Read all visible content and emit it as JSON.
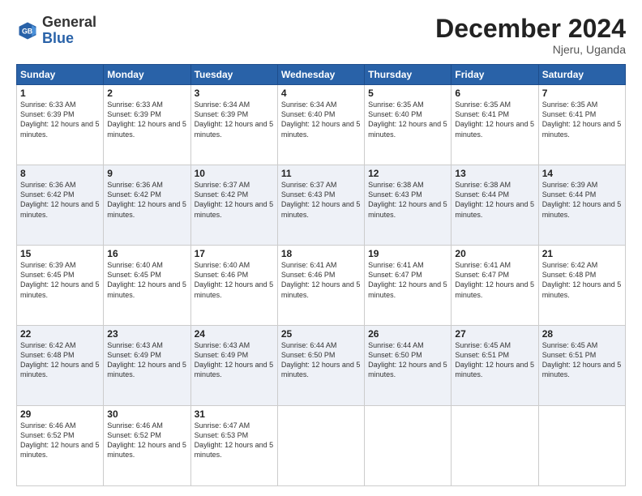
{
  "header": {
    "logo_general": "General",
    "logo_blue": "Blue",
    "month_title": "December 2024",
    "subtitle": "Njeru, Uganda"
  },
  "days_of_week": [
    "Sunday",
    "Monday",
    "Tuesday",
    "Wednesday",
    "Thursday",
    "Friday",
    "Saturday"
  ],
  "weeks": [
    [
      {
        "day": "1",
        "sunrise": "6:33 AM",
        "sunset": "6:39 PM",
        "daylight": "12 hours and 5 minutes."
      },
      {
        "day": "2",
        "sunrise": "6:33 AM",
        "sunset": "6:39 PM",
        "daylight": "12 hours and 5 minutes."
      },
      {
        "day": "3",
        "sunrise": "6:34 AM",
        "sunset": "6:39 PM",
        "daylight": "12 hours and 5 minutes."
      },
      {
        "day": "4",
        "sunrise": "6:34 AM",
        "sunset": "6:40 PM",
        "daylight": "12 hours and 5 minutes."
      },
      {
        "day": "5",
        "sunrise": "6:35 AM",
        "sunset": "6:40 PM",
        "daylight": "12 hours and 5 minutes."
      },
      {
        "day": "6",
        "sunrise": "6:35 AM",
        "sunset": "6:41 PM",
        "daylight": "12 hours and 5 minutes."
      },
      {
        "day": "7",
        "sunrise": "6:35 AM",
        "sunset": "6:41 PM",
        "daylight": "12 hours and 5 minutes."
      }
    ],
    [
      {
        "day": "8",
        "sunrise": "6:36 AM",
        "sunset": "6:42 PM",
        "daylight": "12 hours and 5 minutes."
      },
      {
        "day": "9",
        "sunrise": "6:36 AM",
        "sunset": "6:42 PM",
        "daylight": "12 hours and 5 minutes."
      },
      {
        "day": "10",
        "sunrise": "6:37 AM",
        "sunset": "6:42 PM",
        "daylight": "12 hours and 5 minutes."
      },
      {
        "day": "11",
        "sunrise": "6:37 AM",
        "sunset": "6:43 PM",
        "daylight": "12 hours and 5 minutes."
      },
      {
        "day": "12",
        "sunrise": "6:38 AM",
        "sunset": "6:43 PM",
        "daylight": "12 hours and 5 minutes."
      },
      {
        "day": "13",
        "sunrise": "6:38 AM",
        "sunset": "6:44 PM",
        "daylight": "12 hours and 5 minutes."
      },
      {
        "day": "14",
        "sunrise": "6:39 AM",
        "sunset": "6:44 PM",
        "daylight": "12 hours and 5 minutes."
      }
    ],
    [
      {
        "day": "15",
        "sunrise": "6:39 AM",
        "sunset": "6:45 PM",
        "daylight": "12 hours and 5 minutes."
      },
      {
        "day": "16",
        "sunrise": "6:40 AM",
        "sunset": "6:45 PM",
        "daylight": "12 hours and 5 minutes."
      },
      {
        "day": "17",
        "sunrise": "6:40 AM",
        "sunset": "6:46 PM",
        "daylight": "12 hours and 5 minutes."
      },
      {
        "day": "18",
        "sunrise": "6:41 AM",
        "sunset": "6:46 PM",
        "daylight": "12 hours and 5 minutes."
      },
      {
        "day": "19",
        "sunrise": "6:41 AM",
        "sunset": "6:47 PM",
        "daylight": "12 hours and 5 minutes."
      },
      {
        "day": "20",
        "sunrise": "6:41 AM",
        "sunset": "6:47 PM",
        "daylight": "12 hours and 5 minutes."
      },
      {
        "day": "21",
        "sunrise": "6:42 AM",
        "sunset": "6:48 PM",
        "daylight": "12 hours and 5 minutes."
      }
    ],
    [
      {
        "day": "22",
        "sunrise": "6:42 AM",
        "sunset": "6:48 PM",
        "daylight": "12 hours and 5 minutes."
      },
      {
        "day": "23",
        "sunrise": "6:43 AM",
        "sunset": "6:49 PM",
        "daylight": "12 hours and 5 minutes."
      },
      {
        "day": "24",
        "sunrise": "6:43 AM",
        "sunset": "6:49 PM",
        "daylight": "12 hours and 5 minutes."
      },
      {
        "day": "25",
        "sunrise": "6:44 AM",
        "sunset": "6:50 PM",
        "daylight": "12 hours and 5 minutes."
      },
      {
        "day": "26",
        "sunrise": "6:44 AM",
        "sunset": "6:50 PM",
        "daylight": "12 hours and 5 minutes."
      },
      {
        "day": "27",
        "sunrise": "6:45 AM",
        "sunset": "6:51 PM",
        "daylight": "12 hours and 5 minutes."
      },
      {
        "day": "28",
        "sunrise": "6:45 AM",
        "sunset": "6:51 PM",
        "daylight": "12 hours and 5 minutes."
      }
    ],
    [
      {
        "day": "29",
        "sunrise": "6:46 AM",
        "sunset": "6:52 PM",
        "daylight": "12 hours and 5 minutes."
      },
      {
        "day": "30",
        "sunrise": "6:46 AM",
        "sunset": "6:52 PM",
        "daylight": "12 hours and 5 minutes."
      },
      {
        "day": "31",
        "sunrise": "6:47 AM",
        "sunset": "6:53 PM",
        "daylight": "12 hours and 5 minutes."
      },
      null,
      null,
      null,
      null
    ]
  ]
}
